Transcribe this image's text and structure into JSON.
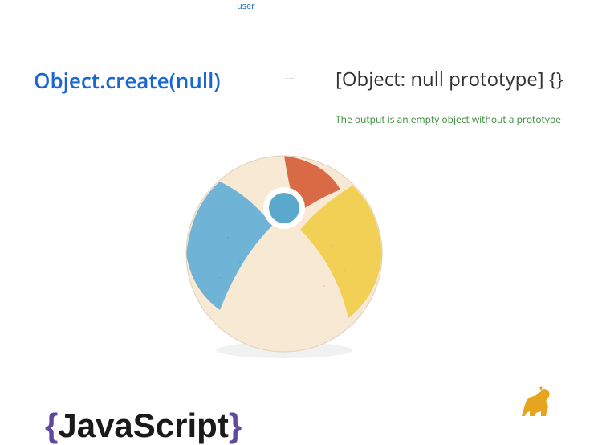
{
  "top_label": "user",
  "code": "Object.create(null)",
  "result": "[Object: null prototype] {}",
  "caption": "The output is an empty object without a prototype",
  "footer": {
    "brace_open": "{",
    "text": "JavaScript",
    "brace_close": "}"
  },
  "colors": {
    "link_blue": "#1a67d2",
    "text_dark": "#333",
    "caption_green": "#3a8c3a",
    "brace_purple": "#5b4a9e",
    "ball_cream": "#f8e9d4",
    "ball_blue": "#6fb3d6",
    "ball_yellow": "#f2cf55",
    "ball_orange": "#d86a46",
    "ball_center": "#5aa8cc",
    "sphinx": "#e6a51e"
  }
}
